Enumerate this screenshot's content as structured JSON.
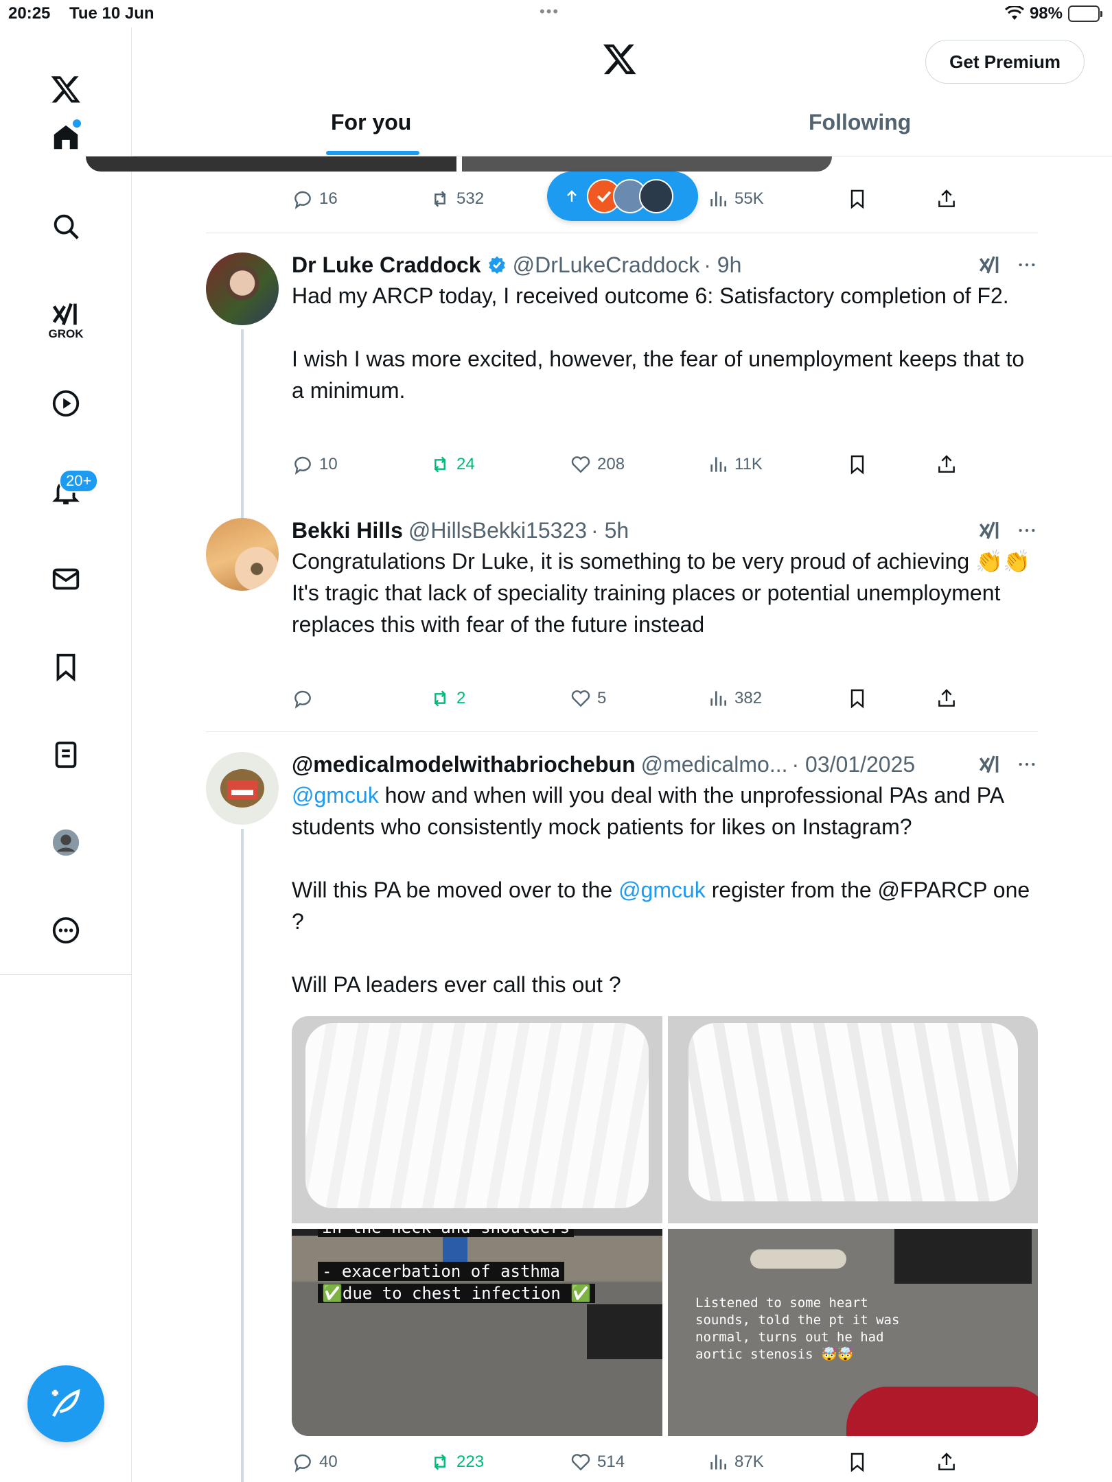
{
  "status_bar": {
    "time": "20:25",
    "date": "Tue 10 Jun",
    "battery": "98%"
  },
  "sidebar": {
    "grok_label": "GROK",
    "notifications_badge": "20+"
  },
  "header": {
    "premium_label": "Get Premium",
    "tabs": [
      {
        "label": "For you"
      },
      {
        "label": "Following"
      }
    ]
  },
  "top_tweet_actions": {
    "replies": "16",
    "reposts": "532",
    "views": "55K"
  },
  "tweets": [
    {
      "name": "Dr Luke Craddock",
      "handle": "@DrLukeCraddock",
      "time": "· 9h",
      "verified": true,
      "body": "Had my ARCP today, I received outcome 6: Satisfactory completion of F2.\n\nI wish I was more excited, however, the fear of unemployment keeps that to a minimum.",
      "replies": "10",
      "reposts": "24",
      "likes": "208",
      "views": "11K"
    },
    {
      "name": "Bekki Hills",
      "handle": "@HillsBekki15323",
      "time": "· 5h",
      "body": "Congratulations Dr Luke, it is something to be very proud of achieving 👏👏\nIt's tragic that lack of speciality training places or potential unemployment replaces this with fear of the future instead",
      "replies": "",
      "reposts": "2",
      "likes": "5",
      "views": "382"
    },
    {
      "name": "@medicalmodelwithabriochebun",
      "handle": "@medicalmo...",
      "time": "· 03/01/2025",
      "mention1": "@gmcuk",
      "body1": " how and when will you deal with the unprofessional PAs and PA students who consistently mock patients for likes on Instagram?\n\nWill this PA be moved over to the ",
      "mention2": "@gmcuk",
      "body2": " register from the @FPARCP one ?\n\nWill PA leaders ever call this out ?",
      "media_captions": {
        "c1_line0": "in the neck and shoulders",
        "c1_line1": "- exacerbation of asthma",
        "c1_line2": "✅due to chest infection ✅",
        "c2": "Listened to some heart\nsounds, told the pt it was\nnormal, turns out he had\naortic stenosis 🤯🤯"
      },
      "replies": "40",
      "reposts": "223",
      "likes": "514",
      "views": "87K"
    }
  ],
  "colors": {
    "accent": "#1d9bf0",
    "repost_active": "#00ba7c",
    "text_secondary": "#536471"
  }
}
